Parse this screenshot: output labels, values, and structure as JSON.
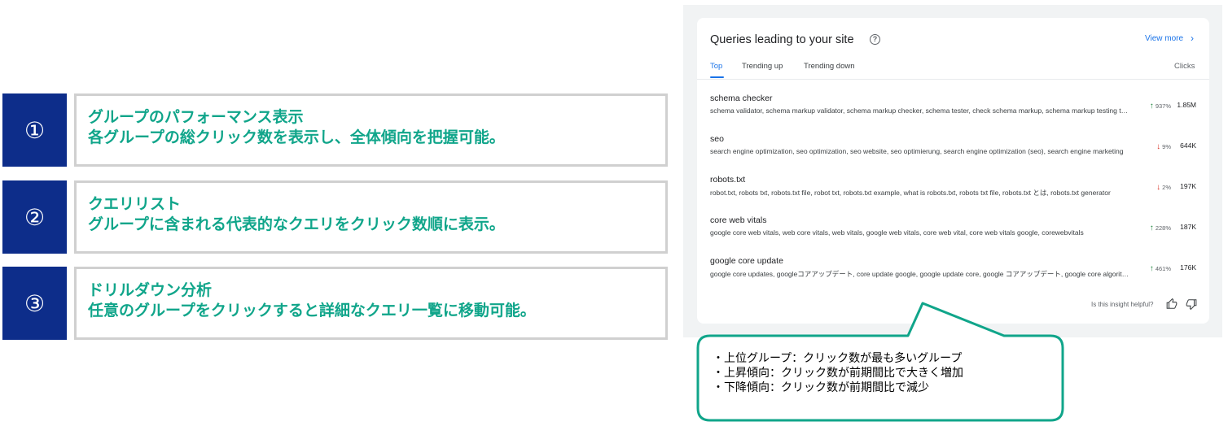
{
  "features": [
    {
      "number": "①",
      "title": "グループのパフォーマンス表示",
      "description": "各グループの総クリック数を表示し、全体傾向を把握可能。"
    },
    {
      "number": "②",
      "title": "クエリリスト",
      "description": "グループに含まれる代表的なクエリをクリック数順に表示。"
    },
    {
      "number": "③",
      "title": "ドリルダウン分析",
      "description": "任意のグループをクリックすると詳細なクエリ一覧に移動可能。"
    }
  ],
  "card": {
    "title": "Queries leading to your site",
    "help_icon": "?",
    "view_more": "View more",
    "view_more_icon": "›",
    "tabs": [
      "Top",
      "Trending up",
      "Trending down"
    ],
    "clicks_header": "Clicks",
    "queries": [
      {
        "title": "schema checker",
        "subtitle": "schema validator, schema markup validator, schema markup checker, schema tester, check schema markup, schema markup testing tool",
        "trend": "937%",
        "trend_direction": "up",
        "arrow": "↑",
        "clicks": "1.85M"
      },
      {
        "title": "seo",
        "subtitle": "search engine optimization, seo optimization, seo website, seo optimierung, search engine optimization (seo), search engine marketing",
        "trend": "9%",
        "trend_direction": "down",
        "arrow": "↓",
        "clicks": "644K"
      },
      {
        "title": "robots.txt",
        "subtitle": "robot.txt, robots txt, robots.txt file, robot txt, robots.txt example, what is robots.txt, robots txt file, robots.txt とは, robots.txt generator",
        "trend": "2%",
        "trend_direction": "down",
        "arrow": "↓",
        "clicks": "197K"
      },
      {
        "title": "core web vitals",
        "subtitle": "google core web vitals, web core vitals, web vitals, google web vitals, core web vital, core web vitals google, corewebvitals",
        "trend": "228%",
        "trend_direction": "up",
        "arrow": "↑",
        "clicks": "187K"
      },
      {
        "title": "google core update",
        "subtitle": "google core updates, googleコアアップデート, core update google, google update core, google コアアップデート, google core algorithm update",
        "trend": "461%",
        "trend_direction": "up",
        "arrow": "↑",
        "clicks": "176K"
      }
    ],
    "helpful_text": "Is this insight helpful?",
    "thumbs_up_icon": "thumbs-up",
    "thumbs_down_icon": "thumbs-down",
    "colors": {
      "accent": "#1a73e8",
      "up": "#188038",
      "down": "#d93025"
    }
  },
  "callout": {
    "lines": [
      "・上位グループ：クリック数が最も多いグループ",
      "・上昇傾向：クリック数が前期間比で大きく増加",
      "・下降傾向：クリック数が前期間比で減少"
    ],
    "border_color": "#10a58a"
  }
}
